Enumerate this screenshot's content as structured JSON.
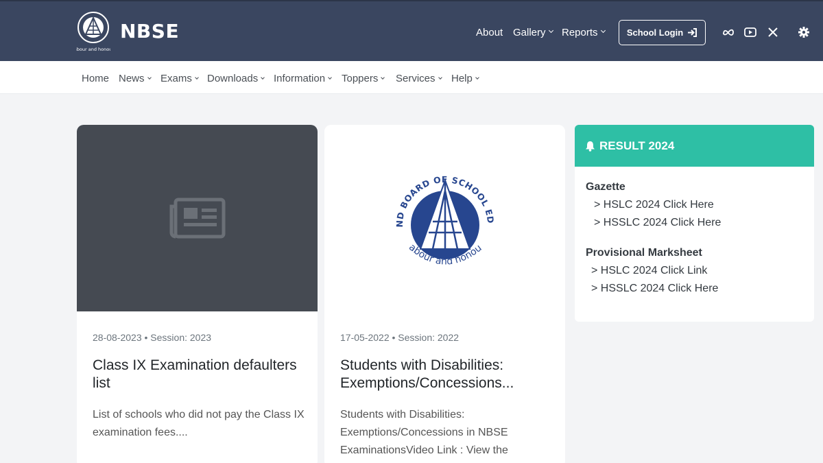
{
  "header": {
    "brand": "NBSE",
    "logo_caption": "labour and honour",
    "nav": [
      {
        "label": "About",
        "dropdown": false
      },
      {
        "label": "Gallery",
        "dropdown": true
      },
      {
        "label": "Reports",
        "dropdown": true
      }
    ],
    "login_label": "School Login",
    "social_icons": [
      "meta-icon",
      "youtube-icon",
      "x-twitter-icon",
      "settings-gear-icon"
    ]
  },
  "menu": [
    {
      "label": "Home",
      "dropdown": false
    },
    {
      "label": "News",
      "dropdown": true
    },
    {
      "label": "Exams",
      "dropdown": true
    },
    {
      "label": "Downloads",
      "dropdown": true
    },
    {
      "label": "Information",
      "dropdown": true
    },
    {
      "label": "Toppers",
      "dropdown": true
    },
    {
      "label": "Services",
      "dropdown": true
    },
    {
      "label": "Help",
      "dropdown": true
    }
  ],
  "cards": [
    {
      "meta": "28-08-2023 • Session: 2023",
      "title": "Class IX Examination defaulters list",
      "desc": "List of schools who did not pay the Class IX examination fees....",
      "image": "newspaper-placeholder-icon"
    },
    {
      "meta": "17-05-2022 • Session: 2022",
      "title": "Students with Disabilities: Exemptions/Concessions...",
      "desc": "Students with Disabilities: Exemptions/Concessions in NBSE ExaminationsVideo Link :  View the",
      "image": "nbse-emblem",
      "emblem_text": "NAGALAND BOARD OF SCHOOL EDUCATION",
      "emblem_motto": "labour and honour"
    }
  ],
  "result": {
    "title": "RESULT 2024",
    "sections": [
      {
        "heading": "Gazette",
        "links": [
          "> HSLC 2024 Click Here",
          "> HSSLC 2024 Click Here"
        ]
      },
      {
        "heading": "Provisional Marksheet",
        "links": [
          "> HSLC 2024 Click Link",
          "> HSSLC 2024 Click Here"
        ]
      }
    ]
  },
  "colors": {
    "header_bg": "#3a4660",
    "result_accent": "#2ebfa5",
    "emblem_blue": "#27468f",
    "placeholder_bg": "#454a52"
  }
}
